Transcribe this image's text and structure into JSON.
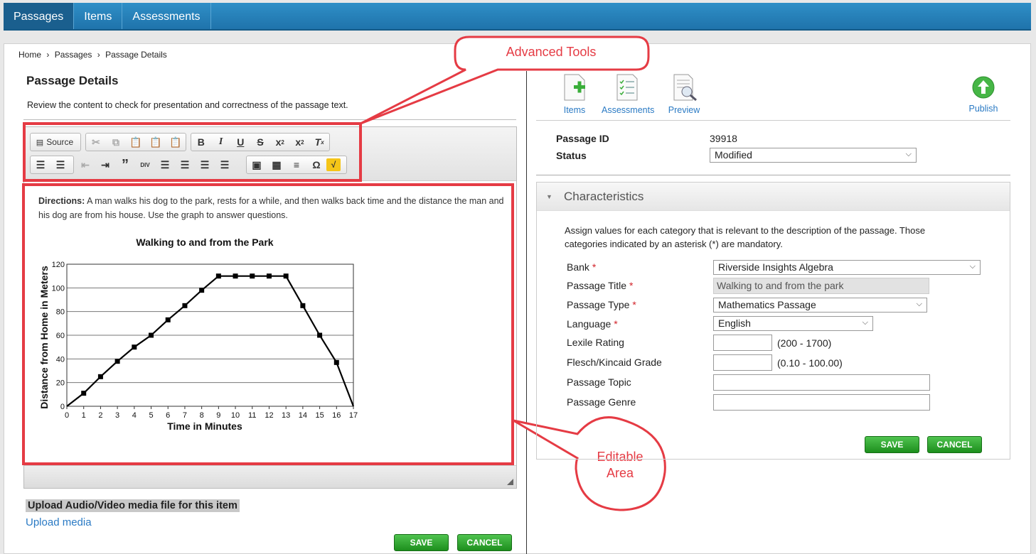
{
  "nav": {
    "tabs": [
      "Passages",
      "Items",
      "Assessments"
    ]
  },
  "breadcrumb": {
    "home": "Home",
    "sep": "›",
    "passages": "Passages",
    "current": "Passage Details"
  },
  "left": {
    "title": "Passage Details",
    "description": "Review the content to check for presentation and correctness of the passage text.",
    "source_label": "Source",
    "directions_label": "Directions:",
    "directions_text": " A man walks his dog to the park, rests for a while, and then walks back time and the distance the man and his dog are from his house. Use the graph to answer questions.",
    "upload_title": "Upload Audio/Video media file for this item",
    "upload_link": "Upload media",
    "save": "SAVE",
    "cancel": "CANCEL"
  },
  "callouts": {
    "advanced": "Advanced Tools",
    "editable_line1": "Editable",
    "editable_line2": "Area"
  },
  "chart_data": {
    "type": "line",
    "title": "Walking to and from the Park",
    "xlabel": "Time in Minutes",
    "ylabel": "Distance from Home in Meters",
    "xlim": [
      0,
      17
    ],
    "ylim": [
      0,
      120
    ],
    "x_ticks": [
      0,
      1,
      2,
      3,
      4,
      5,
      6,
      7,
      8,
      9,
      10,
      11,
      12,
      13,
      14,
      15,
      16,
      17
    ],
    "y_ticks": [
      0,
      20,
      40,
      60,
      80,
      100,
      120
    ],
    "x": [
      0,
      1,
      2,
      3,
      4,
      5,
      6,
      7,
      8,
      9,
      10,
      11,
      12,
      13,
      14,
      15,
      16,
      17
    ],
    "y": [
      0,
      11,
      25,
      38,
      50,
      60,
      73,
      85,
      98,
      110,
      110,
      110,
      110,
      110,
      85,
      60,
      37,
      0
    ],
    "grid": "horizontal"
  },
  "right": {
    "tools": {
      "items": "Items",
      "assessments": "Assessments",
      "preview": "Preview",
      "publish": "Publish"
    },
    "passage_id_label": "Passage ID",
    "passage_id": "39918",
    "status_label": "Status",
    "status_value": "Modified",
    "characteristics": "Characteristics",
    "instructions": "Assign values for each category that is relevant to the description of the passage. Those categories indicated by an asterisk (*) are mandatory.",
    "fields": {
      "bank_label": "Bank",
      "bank_value": "Riverside Insights Algebra",
      "title_label": "Passage Title",
      "title_value": "Walking to and from the park",
      "type_label": "Passage Type",
      "type_value": "Mathematics Passage",
      "language_label": "Language",
      "language_value": "English",
      "lexile_label": "Lexile Rating",
      "lexile_range": "(200 - 1700)",
      "flesch_label": "Flesch/Kincaid Grade",
      "flesch_range": "(0.10 - 100.00)",
      "topic_label": "Passage Topic",
      "genre_label": "Passage Genre",
      "star": "*"
    },
    "save": "SAVE",
    "cancel": "CANCEL"
  }
}
